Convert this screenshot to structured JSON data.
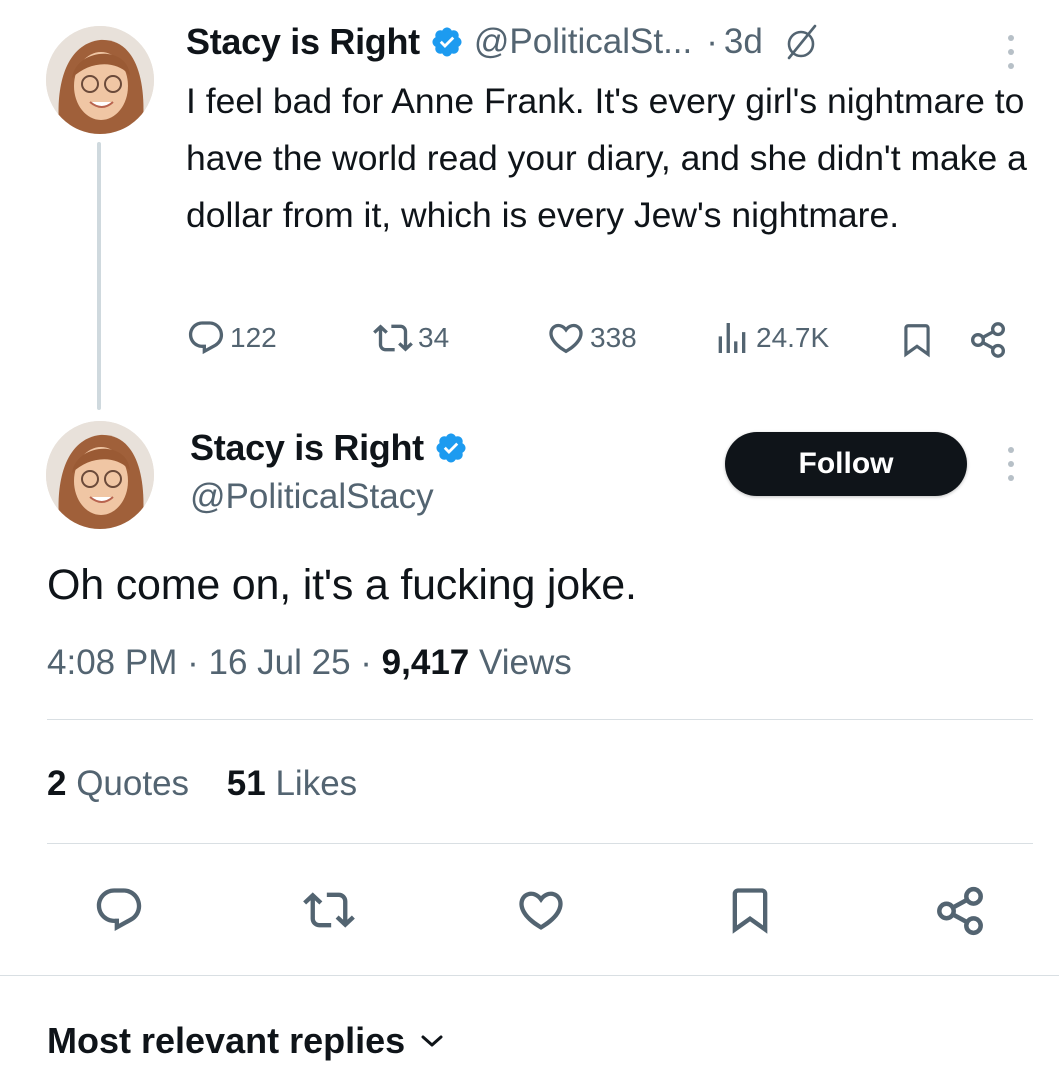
{
  "parent_tweet": {
    "author_name": "Stacy is Right",
    "handle": "@PoliticalSt...",
    "separator": "·",
    "time": "3d",
    "text": "I feel bad for Anne Frank. It's every girl's nightmare to have the world read your diary, and she didn't make a dollar from it, which is every Jew's nightmare.",
    "metrics": {
      "replies": "122",
      "reposts": "34",
      "likes": "338",
      "views": "24.7K"
    }
  },
  "main_tweet": {
    "author_name": "Stacy is Right",
    "handle": "@PoliticalStacy",
    "follow_label": "Follow",
    "text": "Oh come on, it's a fucking joke.",
    "time": "4:08 PM",
    "date": "16 Jul 25",
    "dot": "·",
    "views_count": "9,417",
    "views_label": "Views",
    "quotes_count": "2",
    "quotes_label": "Quotes",
    "likes_count": "51",
    "likes_label": "Likes"
  },
  "replies_section": {
    "heading": "Most relevant replies"
  },
  "colors": {
    "text": "#0f1419",
    "muted": "#536471",
    "verified": "#1d9bf0",
    "divider": "#d9dfe3",
    "thread_line": "#cfd9de"
  },
  "icons": [
    "verified-badge-icon",
    "grok-slash-icon",
    "more-vertical-icon",
    "reply-icon",
    "repost-icon",
    "like-icon",
    "views-icon",
    "bookmark-icon",
    "share-icon",
    "chevron-down-icon"
  ]
}
